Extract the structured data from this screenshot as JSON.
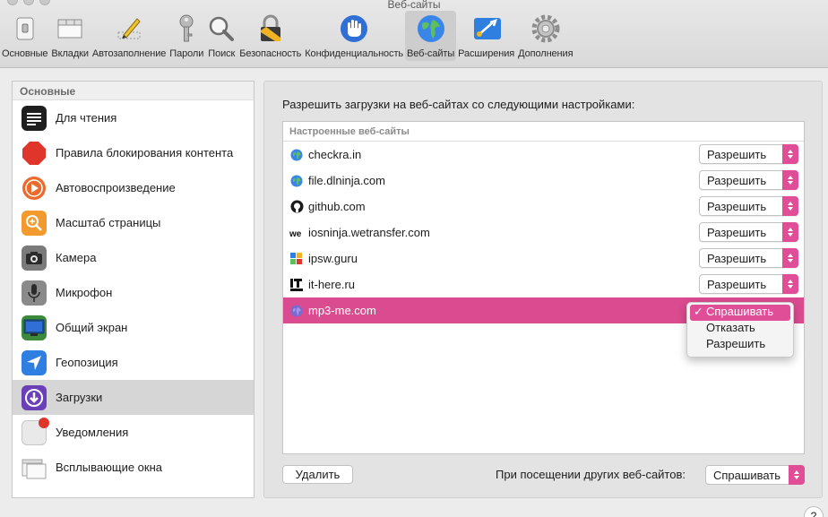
{
  "window": {
    "title": "Веб-сайты"
  },
  "toolbar": {
    "items": [
      {
        "label": "Основные",
        "icon": "switch-icon"
      },
      {
        "label": "Вкладки",
        "icon": "tabs-icon"
      },
      {
        "label": "Автозаполнение",
        "icon": "pencil-icon"
      },
      {
        "label": "Пароли",
        "icon": "key-icon"
      },
      {
        "label": "Поиск",
        "icon": "search-icon"
      },
      {
        "label": "Безопасность",
        "icon": "lock-icon"
      },
      {
        "label": "Конфиденциальность",
        "icon": "hand-icon"
      },
      {
        "label": "Веб-сайты",
        "icon": "globe-icon",
        "active": true
      },
      {
        "label": "Расширения",
        "icon": "puzzle-icon"
      },
      {
        "label": "Дополнения",
        "icon": "gear-icon"
      }
    ]
  },
  "sidebar": {
    "header": "Основные",
    "items": [
      {
        "label": "Для чтения",
        "icon": "reader-icon"
      },
      {
        "label": "Правила блокирования контента",
        "icon": "stop-sign-icon"
      },
      {
        "label": "Автовоспроизведение",
        "icon": "play-icon"
      },
      {
        "label": "Масштаб страницы",
        "icon": "zoom-icon"
      },
      {
        "label": "Камера",
        "icon": "camera-icon"
      },
      {
        "label": "Микрофон",
        "icon": "microphone-icon"
      },
      {
        "label": "Общий экран",
        "icon": "screen-icon"
      },
      {
        "label": "Геопозиция",
        "icon": "location-icon"
      },
      {
        "label": "Загрузки",
        "icon": "download-icon",
        "selected": true
      },
      {
        "label": "Уведомления",
        "icon": "notifications-icon"
      },
      {
        "label": "Всплывающие окна",
        "icon": "popup-windows-icon"
      }
    ]
  },
  "main": {
    "title": "Разрешить загрузки на веб-сайтах со следующими настройками:",
    "table_header": "Настроенные веб-сайты",
    "sites": [
      {
        "name": "checkra.in",
        "setting": "Разрешить",
        "icon": "globe-icon"
      },
      {
        "name": "file.dlninja.com",
        "setting": "Разрешить",
        "icon": "globe-icon"
      },
      {
        "name": "github.com",
        "setting": "Разрешить",
        "icon": "github-icon"
      },
      {
        "name": "iosninja.wetransfer.com",
        "setting": "Разрешить",
        "icon": "wetransfer-icon"
      },
      {
        "name": "ipsw.guru",
        "setting": "Разрешить",
        "icon": "ipsw-icon"
      },
      {
        "name": "it-here.ru",
        "setting": "Разрешить",
        "icon": "it-here-icon"
      },
      {
        "name": "mp3-me.com",
        "setting": "Спрашивать",
        "icon": "globe-icon",
        "selected": true
      }
    ],
    "dropdown": {
      "options": [
        "Спрашивать",
        "Отказать",
        "Разрешить"
      ],
      "selected": "Спрашивать",
      "check": "✓"
    },
    "delete_button": "Удалить",
    "other_sites_label": "При посещении других веб-сайтов:",
    "other_sites_value": "Спрашивать"
  },
  "help_label": "?",
  "colors": {
    "accent": "#e04e98",
    "selection": "#db4b8f"
  }
}
